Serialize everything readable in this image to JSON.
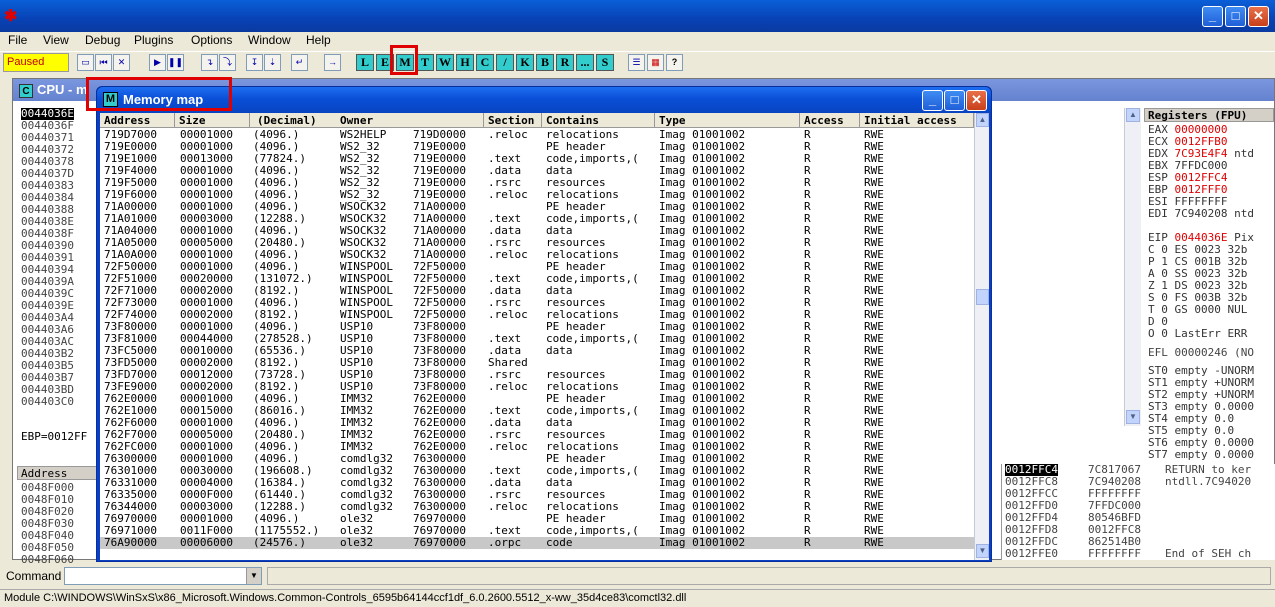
{
  "menu": [
    "File",
    "View",
    "Debug",
    "Plugins",
    "Options",
    "Window",
    "Help"
  ],
  "status_paused": "Paused",
  "letter_buttons": [
    "L",
    "E",
    "M",
    "T",
    "W",
    "H",
    "C",
    "/",
    "K",
    "B",
    "R",
    "...",
    "S"
  ],
  "cpu_title": "CPU - m",
  "cpu_addresses": [
    "0044036E",
    "0044036F",
    "00440371",
    "00440372",
    "00440378",
    "0044037D",
    "00440383",
    "00440384",
    "00440388",
    "0044038E",
    "0044038F",
    "00440390",
    "00440391",
    "00440394",
    "0044039A",
    "0044039C",
    "0044039E",
    "004403A4",
    "004403A6",
    "004403AC",
    "004403B2",
    "004403B5",
    "004403B7",
    "004403BD",
    "004403C0"
  ],
  "ebp_line": "EBP=0012FF",
  "dump_header": "Address",
  "dump_addresses": [
    "0048F000",
    "0048F010",
    "0048F020",
    "0048F030",
    "0048F040",
    "0048F050",
    "0048F060"
  ],
  "registers_title": "Registers (FPU)",
  "registers": [
    {
      "name": "EAX",
      "value": "00000000",
      "extra": "",
      "red": true
    },
    {
      "name": "ECX",
      "value": "0012FFB0",
      "extra": "",
      "red": true
    },
    {
      "name": "EDX",
      "value": "7C93E4F4",
      "extra": "ntd",
      "red": true
    },
    {
      "name": "EBX",
      "value": "7FFDC000",
      "extra": "",
      "red": false
    },
    {
      "name": "ESP",
      "value": "0012FFC4",
      "extra": "",
      "red": true
    },
    {
      "name": "EBP",
      "value": "0012FFF0",
      "extra": "",
      "red": true
    },
    {
      "name": "ESI",
      "value": "FFFFFFFF",
      "extra": "",
      "red": false
    },
    {
      "name": "EDI",
      "value": "7C940208",
      "extra": "ntd",
      "red": false
    },
    {
      "name": "",
      "value": "",
      "extra": "",
      "red": false
    },
    {
      "name": "EIP",
      "value": "0044036E",
      "extra": "Pix",
      "red": true
    }
  ],
  "flags": [
    "C 0  ES 0023 32b",
    "P 1  CS 001B 32b",
    "A 0  SS 0023 32b",
    "Z 1  DS 0023 32b",
    "S 0  FS 003B 32b",
    "T 0  GS 0000 NUL",
    "D 0",
    "O 0  LastErr ERR"
  ],
  "efl": "EFL 00000246 (NO",
  "fpu": [
    "ST0 empty -UNORM",
    "ST1 empty +UNORM",
    "ST2 empty +UNORM",
    "ST3 empty 0.0000",
    "ST4 empty 0.0",
    "ST5 empty 0.0",
    "ST6 empty 0.0000",
    "ST7 empty 0.0000"
  ],
  "stack": [
    {
      "addr": "0012FFC4",
      "val": "7C817067",
      "cmt": "RETURN to ker"
    },
    {
      "addr": "0012FFC8",
      "val": "7C940208",
      "cmt": "ntdll.7C94020"
    },
    {
      "addr": "0012FFCC",
      "val": "FFFFFFFF",
      "cmt": ""
    },
    {
      "addr": "0012FFD0",
      "val": "7FFDC000",
      "cmt": ""
    },
    {
      "addr": "0012FFD4",
      "val": "80546BFD",
      "cmt": ""
    },
    {
      "addr": "0012FFD8",
      "val": "0012FFC8",
      "cmt": ""
    },
    {
      "addr": "0012FFDC",
      "val": "862514B0",
      "cmt": ""
    },
    {
      "addr": "0012FFE0",
      "val": "FFFFFFFF",
      "cmt": "End of SEH ch"
    }
  ],
  "memory_map": {
    "title": "Memory map",
    "columns": [
      "Address",
      "Size",
      "(Decimal)",
      "Owner",
      "Section",
      "Contains",
      "Type",
      "Access",
      "Initial access"
    ],
    "rows": [
      [
        "719D7000",
        "00001000",
        "(4096.)",
        "WS2HELP",
        "719D0000",
        ".reloc",
        "relocations",
        "Imag 01001002",
        "R",
        "RWE"
      ],
      [
        "719E0000",
        "00001000",
        "(4096.)",
        "WS2_32",
        "719E0000",
        "",
        "PE header",
        "Imag 01001002",
        "R",
        "RWE"
      ],
      [
        "719E1000",
        "00013000",
        "(77824.)",
        "WS2_32",
        "719E0000",
        ".text",
        "code,imports,(",
        "Imag 01001002",
        "R",
        "RWE"
      ],
      [
        "719F4000",
        "00001000",
        "(4096.)",
        "WS2_32",
        "719E0000",
        ".data",
        "data",
        "Imag 01001002",
        "R",
        "RWE"
      ],
      [
        "719F5000",
        "00001000",
        "(4096.)",
        "WS2_32",
        "719E0000",
        ".rsrc",
        "resources",
        "Imag 01001002",
        "R",
        "RWE"
      ],
      [
        "719F6000",
        "00001000",
        "(4096.)",
        "WS2_32",
        "719E0000",
        ".reloc",
        "relocations",
        "Imag 01001002",
        "R",
        "RWE"
      ],
      [
        "71A00000",
        "00001000",
        "(4096.)",
        "WSOCK32",
        "71A00000",
        "",
        "PE header",
        "Imag 01001002",
        "R",
        "RWE"
      ],
      [
        "71A01000",
        "00003000",
        "(12288.)",
        "WSOCK32",
        "71A00000",
        ".text",
        "code,imports,(",
        "Imag 01001002",
        "R",
        "RWE"
      ],
      [
        "71A04000",
        "00001000",
        "(4096.)",
        "WSOCK32",
        "71A00000",
        ".data",
        "data",
        "Imag 01001002",
        "R",
        "RWE"
      ],
      [
        "71A05000",
        "00005000",
        "(20480.)",
        "WSOCK32",
        "71A00000",
        ".rsrc",
        "resources",
        "Imag 01001002",
        "R",
        "RWE"
      ],
      [
        "71A0A000",
        "00001000",
        "(4096.)",
        "WSOCK32",
        "71A00000",
        ".reloc",
        "relocations",
        "Imag 01001002",
        "R",
        "RWE"
      ],
      [
        "72F50000",
        "00001000",
        "(4096.)",
        "WINSPOOL",
        "72F50000",
        "",
        "PE header",
        "Imag 01001002",
        "R",
        "RWE"
      ],
      [
        "72F51000",
        "00020000",
        "(131072.)",
        "WINSPOOL",
        "72F50000",
        ".text",
        "code,imports,(",
        "Imag 01001002",
        "R",
        "RWE"
      ],
      [
        "72F71000",
        "00002000",
        "(8192.)",
        "WINSPOOL",
        "72F50000",
        ".data",
        "data",
        "Imag 01001002",
        "R",
        "RWE"
      ],
      [
        "72F73000",
        "00001000",
        "(4096.)",
        "WINSPOOL",
        "72F50000",
        ".rsrc",
        "resources",
        "Imag 01001002",
        "R",
        "RWE"
      ],
      [
        "72F74000",
        "00002000",
        "(8192.)",
        "WINSPOOL",
        "72F50000",
        ".reloc",
        "relocations",
        "Imag 01001002",
        "R",
        "RWE"
      ],
      [
        "73F80000",
        "00001000",
        "(4096.)",
        "USP10",
        "73F80000",
        "",
        "PE header",
        "Imag 01001002",
        "R",
        "RWE"
      ],
      [
        "73F81000",
        "00044000",
        "(278528.)",
        "USP10",
        "73F80000",
        ".text",
        "code,imports,(",
        "Imag 01001002",
        "R",
        "RWE"
      ],
      [
        "73FC5000",
        "00010000",
        "(65536.)",
        "USP10",
        "73F80000",
        ".data",
        "data",
        "Imag 01001002",
        "R",
        "RWE"
      ],
      [
        "73FD5000",
        "00002000",
        "(8192.)",
        "USP10",
        "73F80000",
        "Shared",
        "",
        "Imag 01001002",
        "R",
        "RWE"
      ],
      [
        "73FD7000",
        "00012000",
        "(73728.)",
        "USP10",
        "73F80000",
        ".rsrc",
        "resources",
        "Imag 01001002",
        "R",
        "RWE"
      ],
      [
        "73FE9000",
        "00002000",
        "(8192.)",
        "USP10",
        "73F80000",
        ".reloc",
        "relocations",
        "Imag 01001002",
        "R",
        "RWE"
      ],
      [
        "762E0000",
        "00001000",
        "(4096.)",
        "IMM32",
        "762E0000",
        "",
        "PE header",
        "Imag 01001002",
        "R",
        "RWE"
      ],
      [
        "762E1000",
        "00015000",
        "(86016.)",
        "IMM32",
        "762E0000",
        ".text",
        "code,imports,(",
        "Imag 01001002",
        "R",
        "RWE"
      ],
      [
        "762F6000",
        "00001000",
        "(4096.)",
        "IMM32",
        "762E0000",
        ".data",
        "data",
        "Imag 01001002",
        "R",
        "RWE"
      ],
      [
        "762F7000",
        "00005000",
        "(20480.)",
        "IMM32",
        "762E0000",
        ".rsrc",
        "resources",
        "Imag 01001002",
        "R",
        "RWE"
      ],
      [
        "762FC000",
        "00001000",
        "(4096.)",
        "IMM32",
        "762E0000",
        ".reloc",
        "relocations",
        "Imag 01001002",
        "R",
        "RWE"
      ],
      [
        "76300000",
        "00001000",
        "(4096.)",
        "comdlg32",
        "76300000",
        "",
        "PE header",
        "Imag 01001002",
        "R",
        "RWE"
      ],
      [
        "76301000",
        "00030000",
        "(196608.)",
        "comdlg32",
        "76300000",
        ".text",
        "code,imports,(",
        "Imag 01001002",
        "R",
        "RWE"
      ],
      [
        "76331000",
        "00004000",
        "(16384.)",
        "comdlg32",
        "76300000",
        ".data",
        "data",
        "Imag 01001002",
        "R",
        "RWE"
      ],
      [
        "76335000",
        "0000F000",
        "(61440.)",
        "comdlg32",
        "76300000",
        ".rsrc",
        "resources",
        "Imag 01001002",
        "R",
        "RWE"
      ],
      [
        "76344000",
        "00003000",
        "(12288.)",
        "comdlg32",
        "76300000",
        ".reloc",
        "relocations",
        "Imag 01001002",
        "R",
        "RWE"
      ],
      [
        "76970000",
        "00001000",
        "(4096.)",
        "ole32",
        "76970000",
        "",
        "PE header",
        "Imag 01001002",
        "R",
        "RWE"
      ],
      [
        "76971000",
        "0011F000",
        "(1175552.)",
        "ole32",
        "76970000",
        ".text",
        "code,imports,(",
        "Imag 01001002",
        "R",
        "RWE"
      ],
      [
        "76A90000",
        "00006000",
        "(24576.)",
        "ole32",
        "76970000",
        ".orpc",
        "code",
        "Imag 01001002",
        "R",
        "RWE"
      ]
    ],
    "selected_row": 34
  },
  "command_label": "Command :",
  "status_module": "Module C:\\WINDOWS\\WinSxS\\x86_Microsoft.Windows.Common-Controls_6595b64144ccf1df_6.0.2600.5512_x-ww_35d4ce83\\comctl32.dll"
}
